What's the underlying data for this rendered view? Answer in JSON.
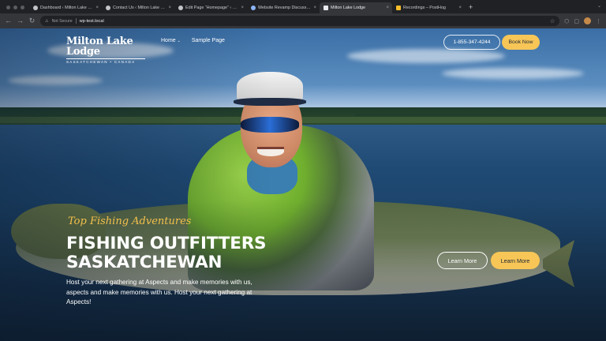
{
  "browser": {
    "tabs": [
      {
        "title": "Dashboard ‹ Milton Lake Lodg",
        "icon": "wordpress-icon"
      },
      {
        "title": "Contact Us ‹ Milton Lake Lod",
        "icon": "wordpress-icon"
      },
      {
        "title": "Edit Page “Homepage” ‹ Milt",
        "icon": "wordpress-icon"
      },
      {
        "title": "Website Revamp Discussion",
        "icon": "globe-icon"
      },
      {
        "title": "Milton Lake Lodge",
        "icon": "site-icon",
        "active": true
      },
      {
        "title": "Recordings – PostHog",
        "icon": "posthog-icon"
      }
    ],
    "new_tab": "+",
    "close_glyph": "×",
    "security_label": "Not Secure",
    "url": "wp-test.local"
  },
  "site": {
    "logo": {
      "name": "Milton Lake Lodge",
      "tagline": "SASKATCHEWAN • CANADA"
    },
    "nav": [
      {
        "label": "Home",
        "has_dropdown": true
      },
      {
        "label": "Sample Page",
        "has_dropdown": false
      }
    ],
    "phone": "1-855-347-4244",
    "book_label": "Book Now",
    "hero": {
      "kicker": "Top Fishing Adventures",
      "title_line1": "FISHING OUTFITTERS",
      "title_line2": "SASKATCHEWAN",
      "description": "Host your next gathering at Aspects and make memories with us, aspects and make memories with us. Host your next gathering at Aspects!",
      "cta_secondary": "Learn More",
      "cta_primary": "Learn More"
    }
  },
  "colors": {
    "accent": "#f7c657",
    "kicker": "#f4c04b",
    "chrome_dark": "#202124",
    "chrome_toolbar": "#35363a"
  }
}
